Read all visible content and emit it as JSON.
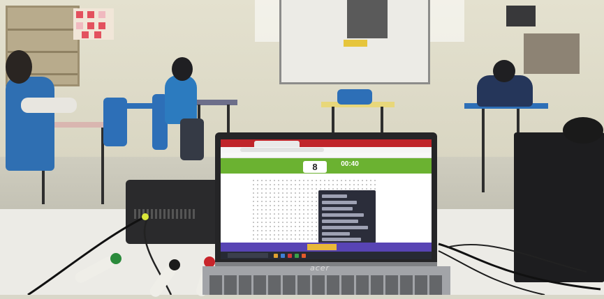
{
  "colors": {
    "wall": "#e4e1cf",
    "chair": "#2d6fb7",
    "browser_red": "#c0242a",
    "game_green": "#6bb231",
    "game_purple": "#5844b4",
    "game_yellow": "#e9b838",
    "menu_dark": "#2b2d3a"
  },
  "laptop": {
    "brand": "acer",
    "screen": {
      "score": "8",
      "timer": "00:40",
      "yellow_button_label": ""
    }
  }
}
